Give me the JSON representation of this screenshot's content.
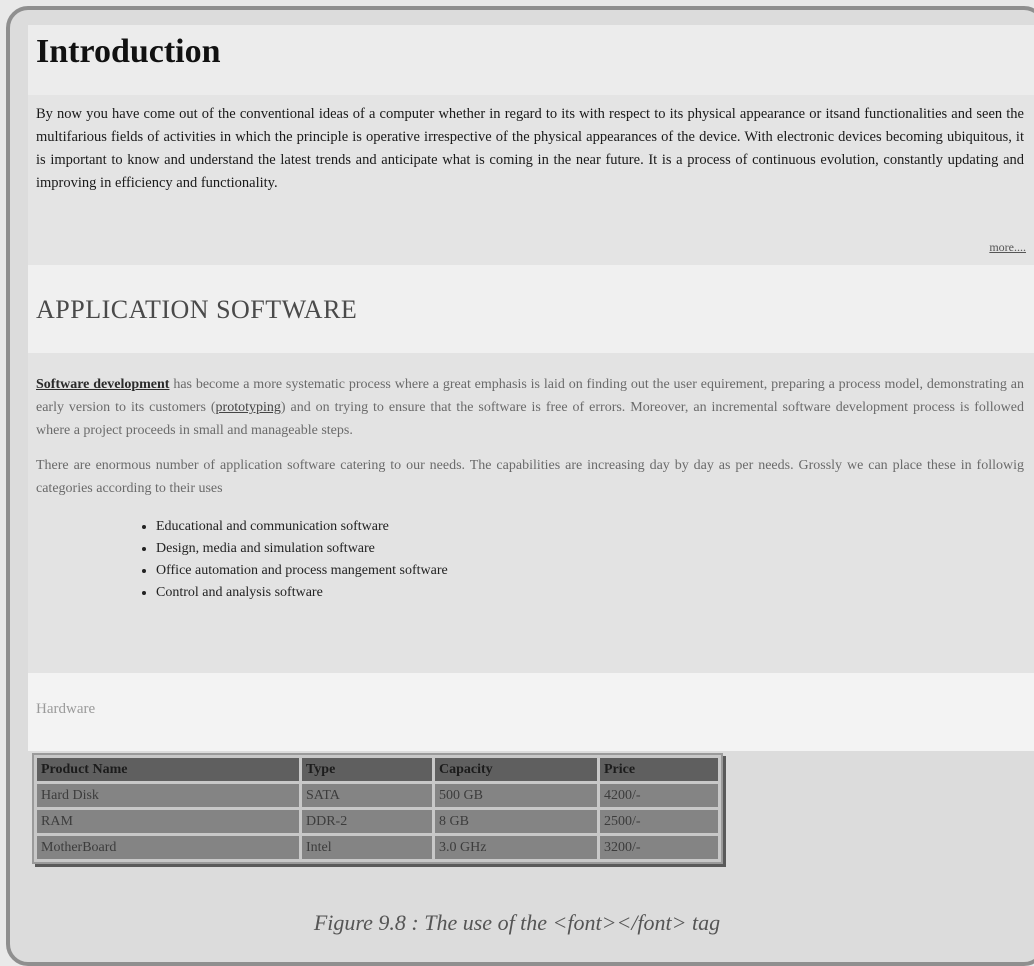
{
  "intro": {
    "title": "Introduction",
    "body": "By now you have come out of the conventional ideas of a computer whether in regard to its with respect to its physical appearance or itsand functionalities and seen the multifarious fields of activities in which the principle is operative irrespective of the physical appearances of the device. With electronic devices becoming ubiquitous, it is important to know and understand the latest trends and anticipate what is coming in the near future. It is a process of continuous evolution, constantly updating and improving in efficiency and functionality.",
    "more_link": "more...."
  },
  "application": {
    "title": "APPLICATION SOFTWARE",
    "para1_link": "Software development",
    "para1_a": " has become a more systematic process where a great emphasis is laid on finding out the user equirement, preparing a process model, demonstrating an early version to its customers (",
    "para1_link2": "prototyping",
    "para1_b": ") and on trying to ensure that the software is free of errors. Moreover, an incremental software development process is followed where a project proceeds in small and manageable steps.",
    "para2": "There are enormous number of application software catering to our needs. The capabilities are increasing day by day as per needs. Grossly we can place these in followig categories according to their uses",
    "list": [
      "Educational and communication software",
      "Design, media and simulation software",
      "Office automation and process mangement software",
      "Control and analysis software"
    ]
  },
  "hardware": {
    "title": "Hardware",
    "headers": [
      "Product Name",
      "Type",
      "Capacity",
      "Price"
    ],
    "rows": [
      [
        "Hard Disk",
        "SATA",
        "500 GB",
        "4200/-"
      ],
      [
        "RAM",
        "DDR-2",
        "8 GB",
        "2500/-"
      ],
      [
        "MotherBoard",
        "Intel",
        "3.0 GHz",
        "3200/-"
      ]
    ]
  },
  "caption": "Figure 9.8 : The use of the <font></font> tag"
}
